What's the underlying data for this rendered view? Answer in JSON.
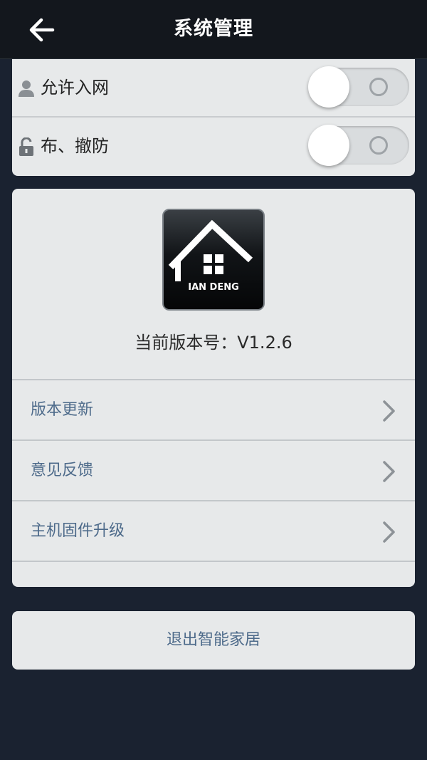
{
  "header": {
    "title": "系统管理",
    "back_icon": "back-arrow-icon"
  },
  "toggles": [
    {
      "label": "允许入网",
      "icon": "user-icon",
      "state": "off"
    },
    {
      "label": "布、撤防",
      "icon": "lock-icon",
      "state": "off"
    }
  ],
  "app_info": {
    "logo_text": "IAN DENG",
    "version_text": "当前版本号：V1.2.6"
  },
  "menu": {
    "items": [
      {
        "label": "版本更新"
      },
      {
        "label": "意见反馈"
      },
      {
        "label": "主机固件升级"
      }
    ]
  },
  "logout": {
    "label": "退出智能家居"
  },
  "colors": {
    "header_bg": "#13171d",
    "page_bg": "#1a2230",
    "card_bg": "#e7e9ea",
    "menu_text": "#4d6a8a"
  }
}
